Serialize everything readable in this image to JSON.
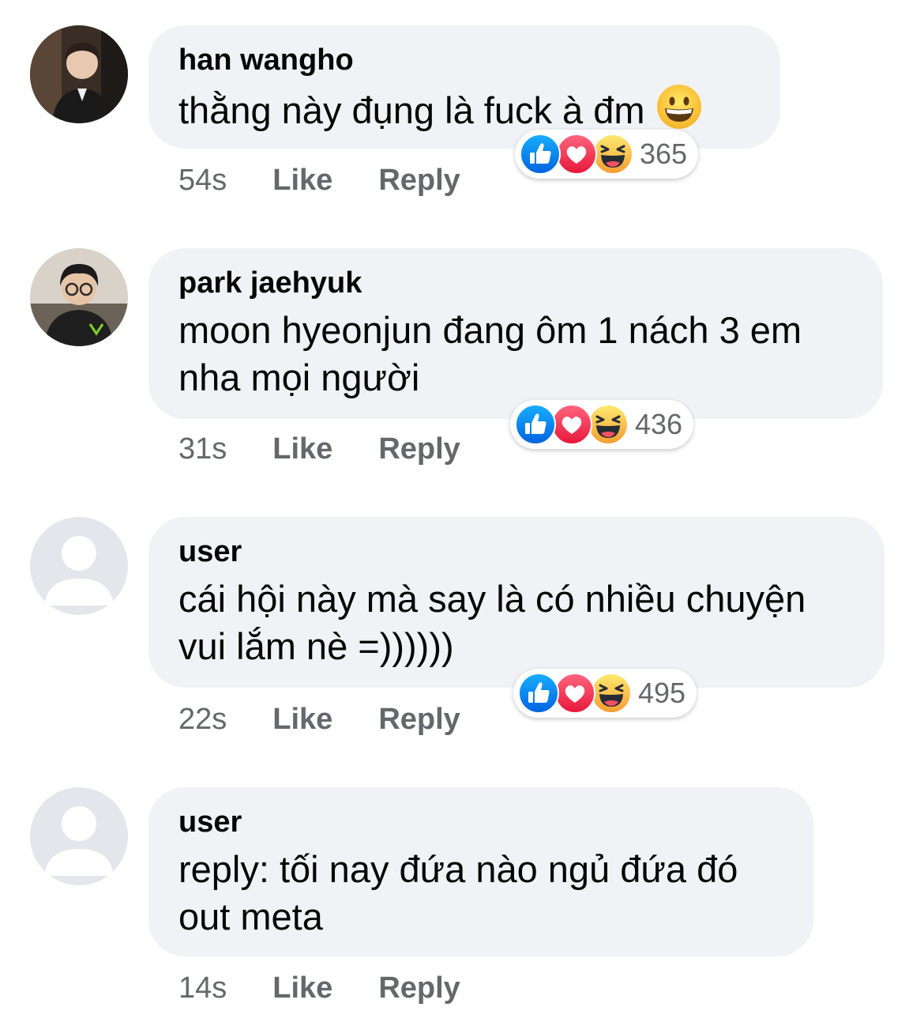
{
  "comments": [
    {
      "author": "han wangho",
      "text": "thằng này đụng là fuck à đm",
      "inline_emoji": "grinning-face-emoji",
      "time": "54s",
      "like_label": "Like",
      "reply_label": "Reply",
      "reaction_count": "365",
      "avatar": "photo-man-in-suit"
    },
    {
      "author": "park jaehyuk",
      "text": "moon hyeonjun đang ôm 1 nách 3 em\nnha mọi người",
      "time": "31s",
      "like_label": "Like",
      "reply_label": "Reply",
      "reaction_count": "436",
      "avatar": "photo-man-with-glasses"
    },
    {
      "author": "user",
      "text": "cái hội này mà say là có nhiều chuyện\nvui lắm nè =))))))",
      "time": "22s",
      "like_label": "Like",
      "reply_label": "Reply",
      "reaction_count": "495",
      "avatar": "default-user-icon"
    },
    {
      "author": "user",
      "text": "reply: tối nay đứa nào ngủ đứa đó\nout meta",
      "time": "14s",
      "like_label": "Like",
      "reply_label": "Reply",
      "avatar": "default-user-icon"
    }
  ],
  "reaction_types": [
    "like-reaction-icon",
    "love-reaction-icon",
    "haha-reaction-icon"
  ],
  "colors": {
    "bubble_bg": "#f0f2f5",
    "meta_text": "#65676b",
    "like_blue": "#1877f2",
    "love_red": "#f33e58",
    "haha_yellow": "#fcc244"
  }
}
